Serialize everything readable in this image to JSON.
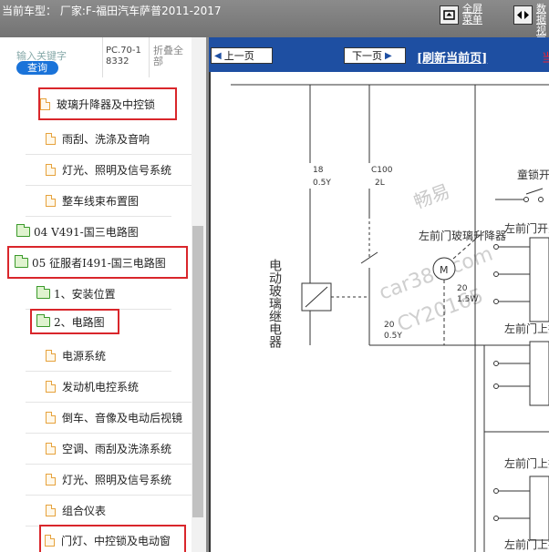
{
  "topbar": {
    "title": "当前车型：  厂家:F-福田汽车萨普2011-2017",
    "fullscreen_label": "全屏菜单",
    "toggle_label": "数据视图"
  },
  "search": {
    "placeholder": "输入关键字",
    "query_button": "查询",
    "pc_code": "PC.70-18332",
    "collapse_all": "折叠全部"
  },
  "tree": {
    "items": [
      {
        "label": "玻璃升降器及中控锁",
        "type": "doc"
      },
      {
        "label": "雨刮、洗涤及音响",
        "type": "doc"
      },
      {
        "label": "灯光、照明及信号系统",
        "type": "doc"
      },
      {
        "label": "整车线束布置图",
        "type": "doc"
      },
      {
        "label": "04 V491-国三电路图",
        "type": "folder"
      },
      {
        "label": "05 征服者I491-国三电路图",
        "type": "folder"
      },
      {
        "label": "1、安装位置",
        "type": "folder"
      },
      {
        "label": "2、电路图",
        "type": "folder"
      },
      {
        "label": "电源系统",
        "type": "doc"
      },
      {
        "label": "发动机电控系统",
        "type": "doc"
      },
      {
        "label": "倒车、音像及电动后视镜",
        "type": "doc"
      },
      {
        "label": "空调、雨刮及洗涤系统",
        "type": "doc"
      },
      {
        "label": "灯光、照明及信号系统",
        "type": "doc"
      },
      {
        "label": "组合仪表",
        "type": "doc"
      },
      {
        "label": "门灯、中控锁及电动窗",
        "type": "doc"
      }
    ]
  },
  "viewer": {
    "prev_page": "上一页",
    "next_page": "下一页",
    "refresh": "[刷新当前页]",
    "edge_char": "当"
  },
  "diagram": {
    "relay_label": "电动玻璃继电器",
    "child_switch": "童锁开",
    "left_front_window_motor": "左前门玻璃升降器",
    "left_front_switch": "左前门开关",
    "left_front_upper_1": "左前门上拍",
    "left_front_upper_2": "左前门上拍",
    "left_front_upper_3": "左前门上拍",
    "wire_18": "18",
    "wire_18_spec": "0.5Y",
    "wire_c100": "C100",
    "wire_c100_pin": "2L",
    "wire_20": "20",
    "wire_20_spec": "1.5W",
    "wire_20b": "20",
    "wire_20b_spec": "0.5Y",
    "motor_symbol": "M",
    "watermark_1": "畅易",
    "watermark_2": "car388.com",
    "watermark_3": "CY20165"
  }
}
